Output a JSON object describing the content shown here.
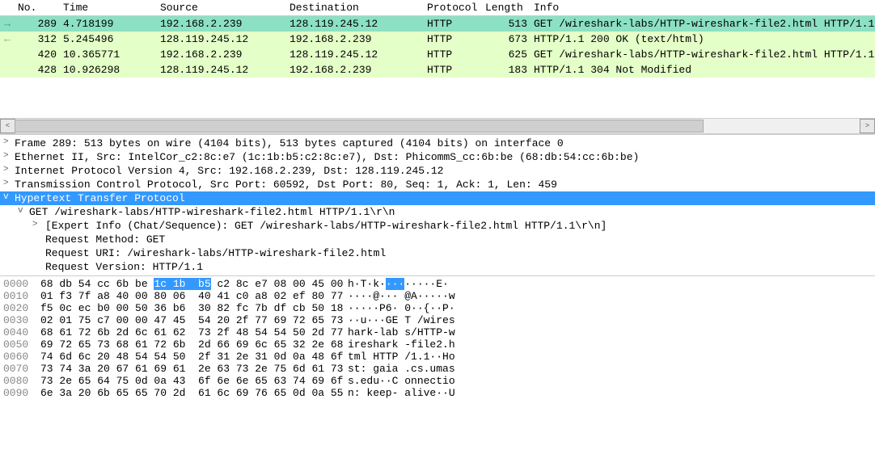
{
  "headers": {
    "no": "No.",
    "time": "Time",
    "source": "Source",
    "destination": "Destination",
    "protocol": "Protocol",
    "length": "Length",
    "info": "Info"
  },
  "packets": [
    {
      "no": "289",
      "time": "4.718199",
      "src": "192.168.2.239",
      "dst": "128.119.245.12",
      "proto": "HTTP",
      "len": "513",
      "info": "GET /wireshark-labs/HTTP-wireshark-file2.html HTTP/1.1"
    },
    {
      "no": "312",
      "time": "5.245496",
      "src": "128.119.245.12",
      "dst": "192.168.2.239",
      "proto": "HTTP",
      "len": "673",
      "info": "HTTP/1.1 200 OK  (text/html)"
    },
    {
      "no": "420",
      "time": "10.365771",
      "src": "192.168.2.239",
      "dst": "128.119.245.12",
      "proto": "HTTP",
      "len": "625",
      "info": "GET /wireshark-labs/HTTP-wireshark-file2.html HTTP/1.1"
    },
    {
      "no": "428",
      "time": "10.926298",
      "src": "128.119.245.12",
      "dst": "192.168.2.239",
      "proto": "HTTP",
      "len": "183",
      "info": "HTTP/1.1 304 Not Modified"
    }
  ],
  "details": {
    "frame": "Frame 289: 513 bytes on wire (4104 bits), 513 bytes captured (4104 bits) on interface 0",
    "ethernet": "Ethernet II, Src: IntelCor_c2:8c:e7 (1c:1b:b5:c2:8c:e7), Dst: PhicommS_cc:6b:be (68:db:54:cc:6b:be)",
    "ip": "Internet Protocol Version 4, Src: 192.168.2.239, Dst: 128.119.245.12",
    "tcp": "Transmission Control Protocol, Src Port: 60592, Dst Port: 80, Seq: 1, Ack: 1, Len: 459",
    "http": "Hypertext Transfer Protocol",
    "request_line": "GET /wireshark-labs/HTTP-wireshark-file2.html HTTP/1.1\\r\\n",
    "expert": "[Expert Info (Chat/Sequence): GET /wireshark-labs/HTTP-wireshark-file2.html HTTP/1.1\\r\\n]",
    "method": "Request Method: GET",
    "uri": "Request URI: /wireshark-labs/HTTP-wireshark-file2.html",
    "version": "Request Version: HTTP/1.1"
  },
  "hex": [
    {
      "off": "0000",
      "b1": "68 db 54 cc 6b be ",
      "hl": "1c 1b  b5",
      "b2": " c2 8c e7 08 00 45 00   ",
      "a1": "h·T·k·",
      "ahl": "···",
      "a2": "·····E·"
    },
    {
      "off": "0010",
      "b": "01 f3 7f a8 40 00 80 06  40 41 c0 a8 02 ef 80 77   ",
      "a": "····@··· @A·····w"
    },
    {
      "off": "0020",
      "b": "f5 0c ec b0 00 50 36 b6  30 82 fc 7b df cb 50 18   ",
      "a": "·····P6· 0··{··P·"
    },
    {
      "off": "0030",
      "b": "02 01 75 c7 00 00 47 45  54 20 2f 77 69 72 65 73   ",
      "a": "··u···GE T /wires"
    },
    {
      "off": "0040",
      "b": "68 61 72 6b 2d 6c 61 62  73 2f 48 54 54 50 2d 77   ",
      "a": "hark-lab s/HTTP-w"
    },
    {
      "off": "0050",
      "b": "69 72 65 73 68 61 72 6b  2d 66 69 6c 65 32 2e 68   ",
      "a": "ireshark -file2.h"
    },
    {
      "off": "0060",
      "b": "74 6d 6c 20 48 54 54 50  2f 31 2e 31 0d 0a 48 6f   ",
      "a": "tml HTTP /1.1··Ho"
    },
    {
      "off": "0070",
      "b": "73 74 3a 20 67 61 69 61  2e 63 73 2e 75 6d 61 73   ",
      "a": "st: gaia .cs.umas"
    },
    {
      "off": "0080",
      "b": "73 2e 65 64 75 0d 0a 43  6f 6e 6e 65 63 74 69 6f   ",
      "a": "s.edu··C onnectio"
    },
    {
      "off": "0090",
      "b": "6e 3a 20 6b 65 65 70 2d  61 6c 69 76 65 0d 0a 55   ",
      "a": "n: keep- alive··U"
    }
  ]
}
